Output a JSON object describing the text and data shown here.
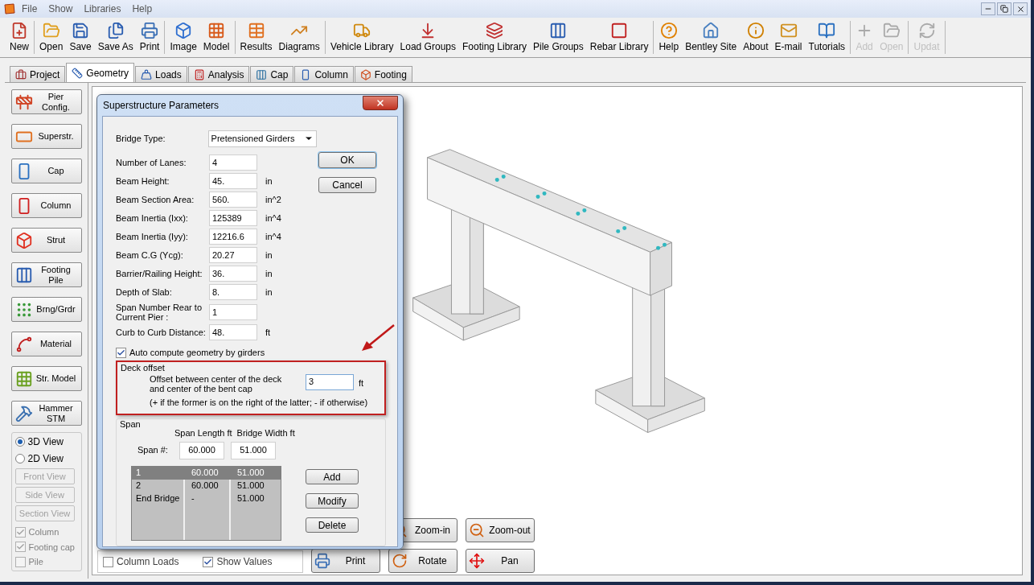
{
  "menu": [
    "File",
    "Show",
    "Libraries",
    "Help"
  ],
  "toolbar": {
    "groups": [
      [
        {
          "label": "New",
          "disabled": false
        }
      ],
      [
        {
          "label": "Open",
          "disabled": false
        },
        {
          "label": "Save",
          "disabled": false
        },
        {
          "label": "Save As",
          "disabled": false
        },
        {
          "label": "Print",
          "disabled": false
        }
      ],
      [
        {
          "label": "Image",
          "disabled": false
        },
        {
          "label": "Model",
          "disabled": false
        }
      ],
      [
        {
          "label": "Results",
          "disabled": false
        },
        {
          "label": "Diagrams",
          "disabled": false
        }
      ],
      [
        {
          "label": "Vehicle Library",
          "disabled": false
        },
        {
          "label": "Load Groups",
          "disabled": false
        },
        {
          "label": "Footing Library",
          "disabled": false
        },
        {
          "label": "Pile Groups",
          "disabled": false
        },
        {
          "label": "Rebar Library",
          "disabled": false
        }
      ],
      [
        {
          "label": "Help",
          "disabled": false
        },
        {
          "label": "Bentley Site",
          "disabled": false
        },
        {
          "label": "About",
          "disabled": false
        },
        {
          "label": "E-mail",
          "disabled": false
        },
        {
          "label": "Tutorials",
          "disabled": false
        }
      ],
      [
        {
          "label": "Add",
          "disabled": true
        },
        {
          "label": "Open",
          "disabled": true
        }
      ],
      [
        {
          "label": "Updat",
          "disabled": true
        }
      ]
    ]
  },
  "tabs": [
    {
      "label": "Project",
      "selected": false
    },
    {
      "label": "Geometry",
      "selected": true
    },
    {
      "label": "Loads",
      "selected": false
    },
    {
      "label": "Analysis",
      "selected": false
    },
    {
      "label": "Cap",
      "selected": false
    },
    {
      "label": "Column",
      "selected": false
    },
    {
      "label": "Footing",
      "selected": false
    }
  ],
  "sidebar": {
    "buttons": [
      {
        "lines": [
          "Pier",
          "Config."
        ]
      },
      {
        "lines": [
          "Superstr."
        ]
      },
      {
        "lines": [
          "Cap"
        ]
      },
      {
        "lines": [
          "Column"
        ]
      },
      {
        "lines": [
          "Strut"
        ]
      },
      {
        "lines": [
          "Footing",
          "Pile"
        ]
      },
      {
        "lines": [
          "Brng/Grdr"
        ]
      },
      {
        "lines": [
          "Material"
        ]
      },
      {
        "lines": [
          "Str. Model"
        ]
      },
      {
        "lines": [
          "Hammer",
          "STM"
        ]
      }
    ],
    "views": [
      {
        "label": "3D View",
        "selected": true
      },
      {
        "label": "2D View",
        "selected": false
      }
    ],
    "view_buttons": [
      {
        "label": "Front View",
        "disabled": true
      },
      {
        "label": "Side View",
        "disabled": true
      },
      {
        "label": "Section View",
        "disabled": true
      }
    ],
    "checkboxes": [
      {
        "label": "Column",
        "checked": true,
        "disabled": true
      },
      {
        "label": "Footing cap",
        "checked": true,
        "disabled": true
      },
      {
        "label": "Pile",
        "checked": false,
        "disabled": true
      }
    ]
  },
  "canvas": {
    "options": [
      {
        "label": "Column Loads",
        "checked": false
      },
      {
        "label": "Show Values",
        "checked": true
      }
    ],
    "buttons": [
      {
        "label": "Zoom-in"
      },
      {
        "label": "Zoom-out"
      },
      {
        "label": "Print"
      },
      {
        "label": "Rotate"
      },
      {
        "label": "Pan"
      }
    ]
  },
  "dialog": {
    "title": "Superstructure Parameters",
    "bridge_type": {
      "label": "Bridge Type:",
      "value": "Pretensioned Girders"
    },
    "fields": [
      {
        "label": "Number of Lanes:",
        "value": "4"
      },
      {
        "label": "Beam Height:",
        "value": "45.",
        "unit": "in"
      },
      {
        "label": "Beam Section Area:",
        "value": "560.",
        "unit": "in^2"
      },
      {
        "label": "Beam Inertia (Ixx):",
        "value": "125389",
        "unit": "in^4"
      },
      {
        "label": "Beam Inertia (Iyy):",
        "value": "12216.6",
        "unit": "in^4"
      },
      {
        "label": "Beam C.G (Ycg):",
        "value": "20.27",
        "unit": "in"
      },
      {
        "label": "Barrier/Railing Height:",
        "value": "36.",
        "unit": "in"
      },
      {
        "label": "Depth of Slab:",
        "value": "8.",
        "unit": "in"
      },
      {
        "label": "Span Number Rear to Current Pier :",
        "value": "1"
      },
      {
        "label": "Curb to Curb Distance:",
        "value": "48.",
        "unit": "ft"
      }
    ],
    "buttons": [
      "OK",
      "Cancel"
    ],
    "auto_compute": {
      "label": "Auto compute geometry by girders",
      "checked": true
    },
    "deck_offset": {
      "title": "Deck offset",
      "label": "Offset between center of the deck and center of the bent cap",
      "value": "3",
      "unit": "ft",
      "note": "(+ if the former is on the right of the latter; - if otherwise)"
    },
    "span": {
      "title": "Span",
      "columns": [
        "",
        "Span Length ft",
        "Bridge Width ft"
      ],
      "input_label": "Span #:",
      "inputs": [
        "60.000",
        "51.000"
      ],
      "rows": [
        {
          "cells": [
            "1",
            "60.000",
            "51.000"
          ],
          "selected": true
        },
        {
          "cells": [
            "2",
            "60.000",
            "51.000"
          ],
          "selected": false
        },
        {
          "cells": [
            "End Bridge",
            "-",
            "51.000"
          ],
          "selected": false
        }
      ],
      "buttons": [
        "Add",
        "Modify",
        "Delete"
      ]
    }
  }
}
